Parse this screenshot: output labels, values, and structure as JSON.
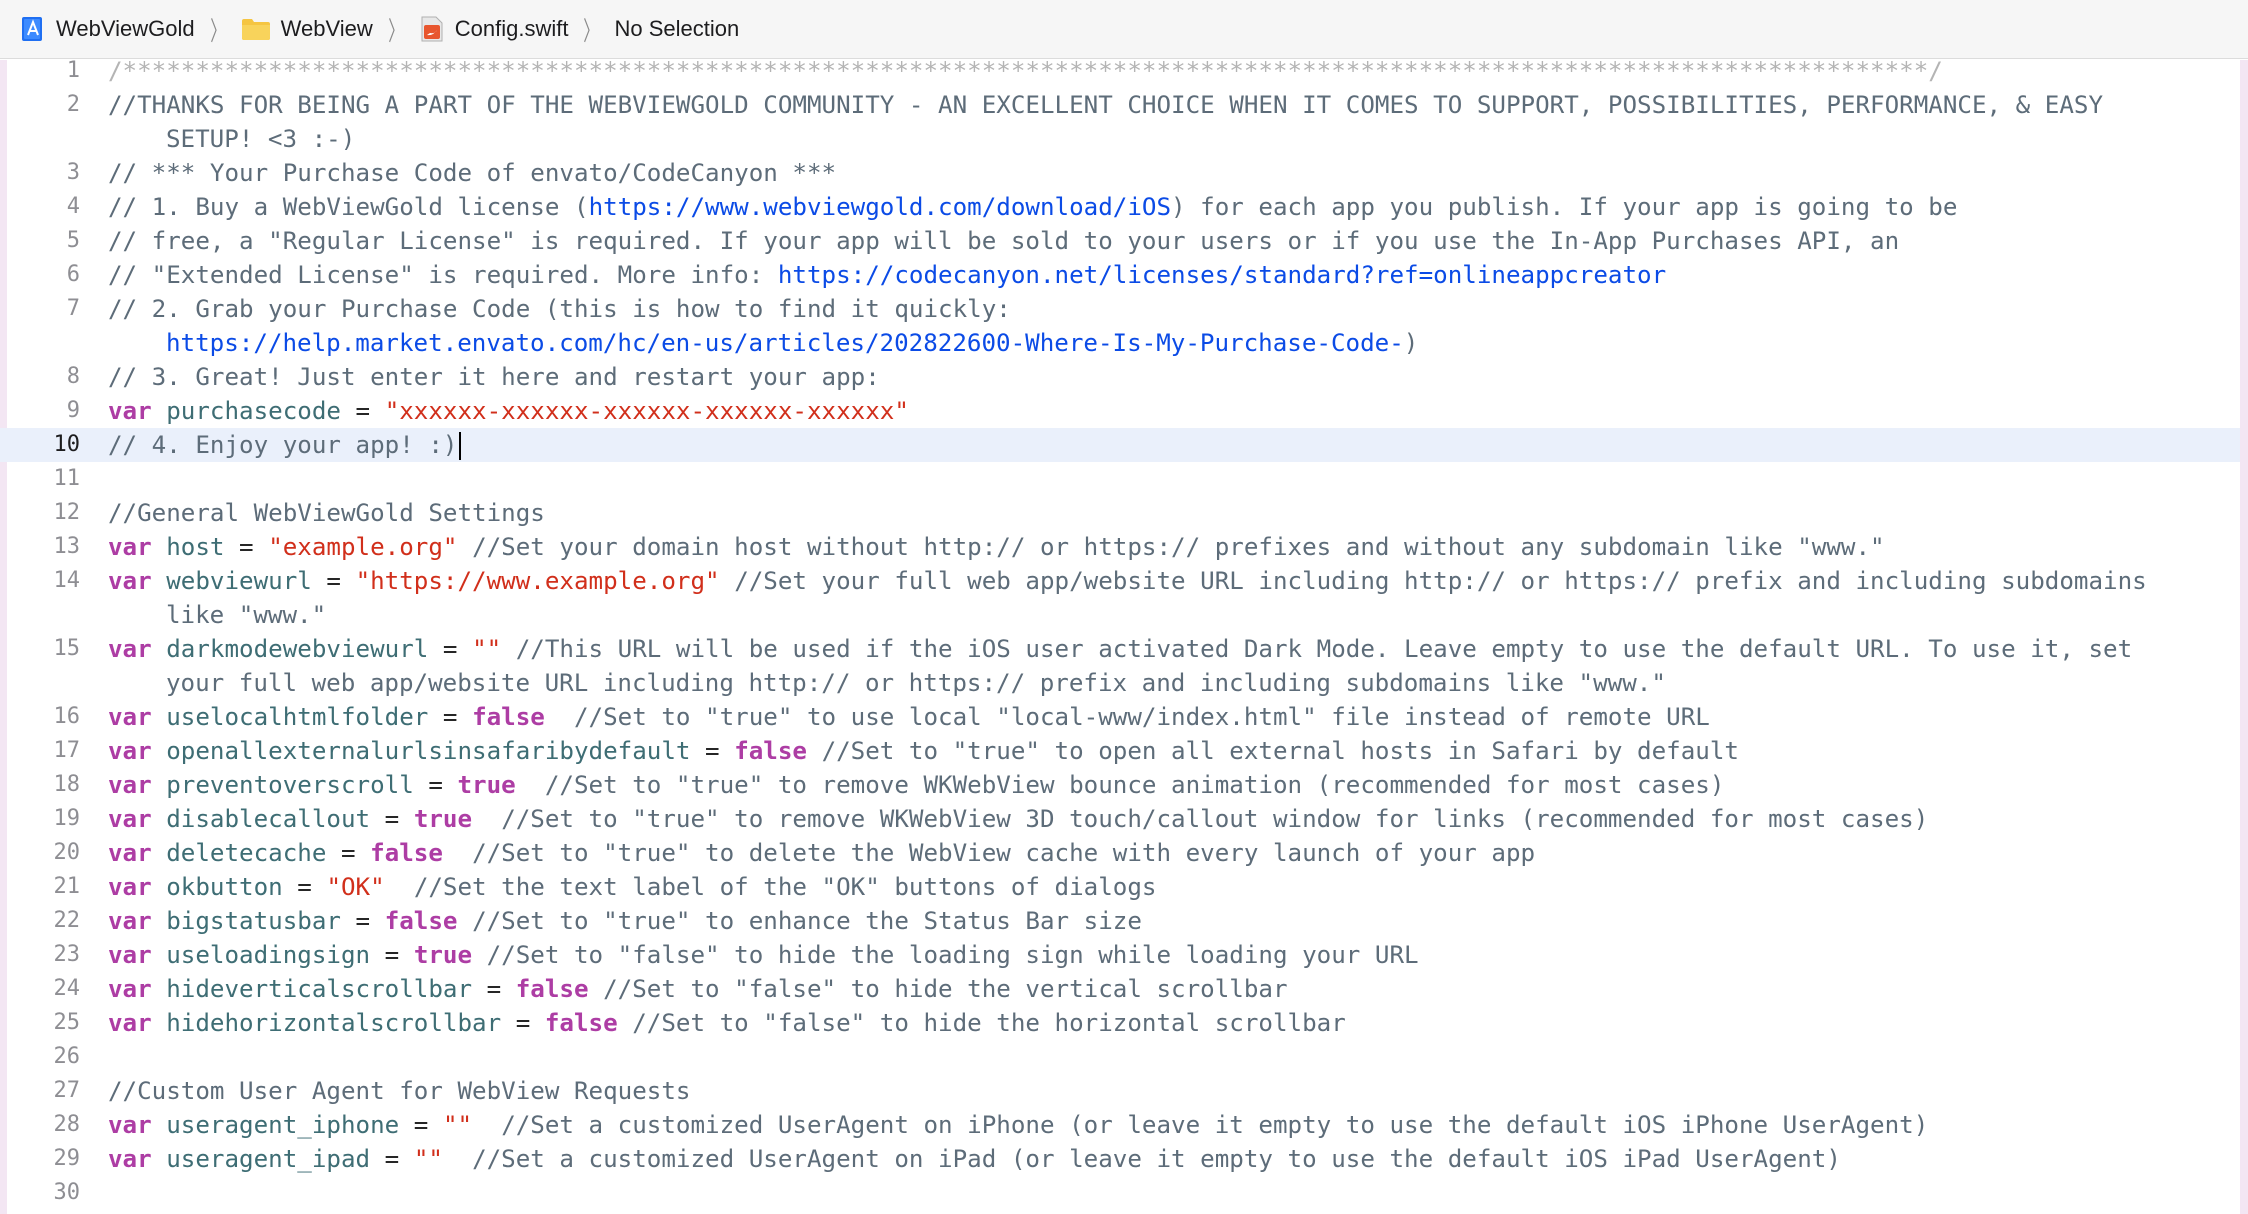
{
  "jumpbar": {
    "project": "WebViewGold",
    "group": "WebView",
    "file": "Config.swift",
    "selection": "No Selection",
    "project_icon": "xcode-project-icon",
    "folder_icon": "folder-icon",
    "file_icon": "swift-file-icon",
    "separator": "〉"
  },
  "editor": {
    "language": "swift",
    "current_line": 10,
    "lines": [
      {
        "n": "1",
        "segs": [
          {
            "t": "dim",
            "v": "/****************************************************************************************************************************/"
          }
        ]
      },
      {
        "n": "2",
        "segs": [
          {
            "t": "cmt",
            "v": "//THANKS FOR BEING A PART OF THE WEBVIEWGOLD COMMUNITY - AN EXCELLENT CHOICE WHEN IT COMES TO SUPPORT, POSSIBILITIES, PERFORMANCE, & EASY"
          }
        ],
        "cont": [
          {
            "t": "cmt",
            "v": "SETUP! <3 :-)"
          }
        ]
      },
      {
        "n": "3",
        "segs": [
          {
            "t": "cmt",
            "v": "// *** Your Purchase Code of envato/CodeCanyon ***"
          }
        ]
      },
      {
        "n": "4",
        "segs": [
          {
            "t": "cmt",
            "v": "// 1. Buy a WebViewGold license ("
          },
          {
            "t": "url",
            "v": "https://www.webviewgold.com/download/iOS"
          },
          {
            "t": "cmt",
            "v": ") for each app you publish. If your app is going to be"
          }
        ]
      },
      {
        "n": "5",
        "segs": [
          {
            "t": "cmt",
            "v": "// free, a \"Regular License\" is required. If your app will be sold to your users or if you use the In-App Purchases API, an"
          }
        ]
      },
      {
        "n": "6",
        "segs": [
          {
            "t": "cmt",
            "v": "// \"Extended License\" is required. More info: "
          },
          {
            "t": "url",
            "v": "https://codecanyon.net/licenses/standard?ref=onlineappcreator"
          }
        ]
      },
      {
        "n": "7",
        "segs": [
          {
            "t": "cmt",
            "v": "// 2. Grab your Purchase Code (this is how to find it quickly:"
          }
        ],
        "cont": [
          {
            "t": "url",
            "v": "https://help.market.envato.com/hc/en-us/articles/202822600-Where-Is-My-Purchase-Code-"
          },
          {
            "t": "cmt",
            "v": ")"
          }
        ]
      },
      {
        "n": "8",
        "segs": [
          {
            "t": "cmt",
            "v": "// 3. Great! Just enter it here and restart your app:"
          }
        ]
      },
      {
        "n": "9",
        "segs": [
          {
            "t": "kw",
            "v": "var"
          },
          {
            "t": "plain",
            "v": " "
          },
          {
            "t": "id",
            "v": "purchasecode"
          },
          {
            "t": "plain",
            "v": " = "
          },
          {
            "t": "str",
            "v": "\"xxxxxx-xxxxxx-xxxxxx-xxxxxx-xxxxxx\""
          }
        ]
      },
      {
        "n": "10",
        "segs": [
          {
            "t": "cmt",
            "v": "// 4. Enjoy your app! :)"
          }
        ]
      },
      {
        "n": "11",
        "segs": []
      },
      {
        "n": "12",
        "segs": [
          {
            "t": "cmt",
            "v": "//General WebViewGold Settings"
          }
        ]
      },
      {
        "n": "13",
        "segs": [
          {
            "t": "kw",
            "v": "var"
          },
          {
            "t": "plain",
            "v": " "
          },
          {
            "t": "id",
            "v": "host"
          },
          {
            "t": "plain",
            "v": " = "
          },
          {
            "t": "str",
            "v": "\"example.org\""
          },
          {
            "t": "plain",
            "v": " "
          },
          {
            "t": "cmt",
            "v": "//Set your domain host without http:// or https:// prefixes and without any subdomain like \"www.\""
          }
        ]
      },
      {
        "n": "14",
        "segs": [
          {
            "t": "kw",
            "v": "var"
          },
          {
            "t": "plain",
            "v": " "
          },
          {
            "t": "id",
            "v": "webviewurl"
          },
          {
            "t": "plain",
            "v": " = "
          },
          {
            "t": "str",
            "v": "\"https://www.example.org\""
          },
          {
            "t": "plain",
            "v": " "
          },
          {
            "t": "cmt",
            "v": "//Set your full web app/website URL including http:// or https:// prefix and including subdomains"
          }
        ],
        "cont": [
          {
            "t": "cmt",
            "v": "like \"www.\""
          }
        ]
      },
      {
        "n": "15",
        "segs": [
          {
            "t": "kw",
            "v": "var"
          },
          {
            "t": "plain",
            "v": " "
          },
          {
            "t": "id",
            "v": "darkmodewebviewurl"
          },
          {
            "t": "plain",
            "v": " = "
          },
          {
            "t": "str",
            "v": "\"\""
          },
          {
            "t": "plain",
            "v": " "
          },
          {
            "t": "cmt",
            "v": "//This URL will be used if the iOS user activated Dark Mode. Leave empty to use the default URL. To use it, set"
          }
        ],
        "cont": [
          {
            "t": "cmt",
            "v": "your full web app/website URL including http:// or https:// prefix and including subdomains like \"www.\""
          }
        ]
      },
      {
        "n": "16",
        "segs": [
          {
            "t": "kw",
            "v": "var"
          },
          {
            "t": "plain",
            "v": " "
          },
          {
            "t": "id",
            "v": "uselocalhtmlfolder"
          },
          {
            "t": "plain",
            "v": " = "
          },
          {
            "t": "kw",
            "v": "false"
          },
          {
            "t": "plain",
            "v": "  "
          },
          {
            "t": "cmt",
            "v": "//Set to \"true\" to use local \"local-www/index.html\" file instead of remote URL"
          }
        ]
      },
      {
        "n": "17",
        "segs": [
          {
            "t": "kw",
            "v": "var"
          },
          {
            "t": "plain",
            "v": " "
          },
          {
            "t": "id",
            "v": "openallexternalurlsinsafaribydefault"
          },
          {
            "t": "plain",
            "v": " = "
          },
          {
            "t": "kw",
            "v": "false"
          },
          {
            "t": "plain",
            "v": " "
          },
          {
            "t": "cmt",
            "v": "//Set to \"true\" to open all external hosts in Safari by default"
          }
        ]
      },
      {
        "n": "18",
        "segs": [
          {
            "t": "kw",
            "v": "var"
          },
          {
            "t": "plain",
            "v": " "
          },
          {
            "t": "id",
            "v": "preventoverscroll"
          },
          {
            "t": "plain",
            "v": " = "
          },
          {
            "t": "kw",
            "v": "true"
          },
          {
            "t": "plain",
            "v": "  "
          },
          {
            "t": "cmt",
            "v": "//Set to \"true\" to remove WKWebView bounce animation (recommended for most cases)"
          }
        ]
      },
      {
        "n": "19",
        "segs": [
          {
            "t": "kw",
            "v": "var"
          },
          {
            "t": "plain",
            "v": " "
          },
          {
            "t": "id",
            "v": "disablecallout"
          },
          {
            "t": "plain",
            "v": " = "
          },
          {
            "t": "kw",
            "v": "true"
          },
          {
            "t": "plain",
            "v": "  "
          },
          {
            "t": "cmt",
            "v": "//Set to \"true\" to remove WKWebView 3D touch/callout window for links (recommended for most cases)"
          }
        ]
      },
      {
        "n": "20",
        "segs": [
          {
            "t": "kw",
            "v": "var"
          },
          {
            "t": "plain",
            "v": " "
          },
          {
            "t": "id",
            "v": "deletecache"
          },
          {
            "t": "plain",
            "v": " = "
          },
          {
            "t": "kw",
            "v": "false"
          },
          {
            "t": "plain",
            "v": "  "
          },
          {
            "t": "cmt",
            "v": "//Set to \"true\" to delete the WebView cache with every launch of your app"
          }
        ]
      },
      {
        "n": "21",
        "segs": [
          {
            "t": "kw",
            "v": "var"
          },
          {
            "t": "plain",
            "v": " "
          },
          {
            "t": "id",
            "v": "okbutton"
          },
          {
            "t": "plain",
            "v": " = "
          },
          {
            "t": "str",
            "v": "\"OK\""
          },
          {
            "t": "plain",
            "v": "  "
          },
          {
            "t": "cmt",
            "v": "//Set the text label of the \"OK\" buttons of dialogs"
          }
        ]
      },
      {
        "n": "22",
        "segs": [
          {
            "t": "kw",
            "v": "var"
          },
          {
            "t": "plain",
            "v": " "
          },
          {
            "t": "id",
            "v": "bigstatusbar"
          },
          {
            "t": "plain",
            "v": " = "
          },
          {
            "t": "kw",
            "v": "false"
          },
          {
            "t": "plain",
            "v": " "
          },
          {
            "t": "cmt",
            "v": "//Set to \"true\" to enhance the Status Bar size"
          }
        ]
      },
      {
        "n": "23",
        "segs": [
          {
            "t": "kw",
            "v": "var"
          },
          {
            "t": "plain",
            "v": " "
          },
          {
            "t": "id",
            "v": "useloadingsign"
          },
          {
            "t": "plain",
            "v": " = "
          },
          {
            "t": "kw",
            "v": "true"
          },
          {
            "t": "plain",
            "v": " "
          },
          {
            "t": "cmt",
            "v": "//Set to \"false\" to hide the loading sign while loading your URL"
          }
        ]
      },
      {
        "n": "24",
        "segs": [
          {
            "t": "kw",
            "v": "var"
          },
          {
            "t": "plain",
            "v": " "
          },
          {
            "t": "id",
            "v": "hideverticalscrollbar"
          },
          {
            "t": "plain",
            "v": " = "
          },
          {
            "t": "kw",
            "v": "false"
          },
          {
            "t": "plain",
            "v": " "
          },
          {
            "t": "cmt",
            "v": "//Set to \"false\" to hide the vertical scrollbar"
          }
        ]
      },
      {
        "n": "25",
        "segs": [
          {
            "t": "kw",
            "v": "var"
          },
          {
            "t": "plain",
            "v": " "
          },
          {
            "t": "id",
            "v": "hidehorizontalscrollbar"
          },
          {
            "t": "plain",
            "v": " = "
          },
          {
            "t": "kw",
            "v": "false"
          },
          {
            "t": "plain",
            "v": " "
          },
          {
            "t": "cmt",
            "v": "//Set to \"false\" to hide the horizontal scrollbar"
          }
        ]
      },
      {
        "n": "26",
        "segs": []
      },
      {
        "n": "27",
        "segs": [
          {
            "t": "cmt",
            "v": "//Custom User Agent for WebView Requests"
          }
        ]
      },
      {
        "n": "28",
        "segs": [
          {
            "t": "kw",
            "v": "var"
          },
          {
            "t": "plain",
            "v": " "
          },
          {
            "t": "id",
            "v": "useragent_iphone"
          },
          {
            "t": "plain",
            "v": " = "
          },
          {
            "t": "str",
            "v": "\"\""
          },
          {
            "t": "plain",
            "v": "  "
          },
          {
            "t": "cmt",
            "v": "//Set a customized UserAgent on iPhone (or leave it empty to use the default iOS iPhone UserAgent)"
          }
        ]
      },
      {
        "n": "29",
        "segs": [
          {
            "t": "kw",
            "v": "var"
          },
          {
            "t": "plain",
            "v": " "
          },
          {
            "t": "id",
            "v": "useragent_ipad"
          },
          {
            "t": "plain",
            "v": " = "
          },
          {
            "t": "str",
            "v": "\"\""
          },
          {
            "t": "plain",
            "v": "  "
          },
          {
            "t": "cmt",
            "v": "//Set a customized UserAgent on iPad (or leave it empty to use the default iOS iPad UserAgent)"
          }
        ]
      },
      {
        "n": "30",
        "segs": []
      }
    ]
  }
}
